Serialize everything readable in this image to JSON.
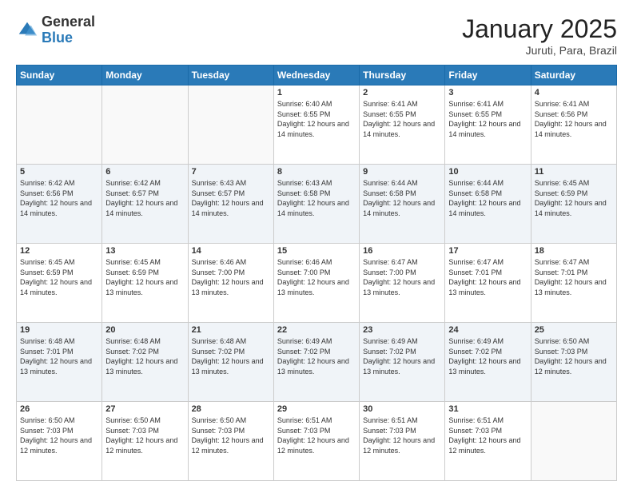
{
  "header": {
    "logo_general": "General",
    "logo_blue": "Blue",
    "month_title": "January 2025",
    "subtitle": "Juruti, Para, Brazil"
  },
  "days_of_week": [
    "Sunday",
    "Monday",
    "Tuesday",
    "Wednesday",
    "Thursday",
    "Friday",
    "Saturday"
  ],
  "weeks": [
    [
      {
        "day": "",
        "sunrise": "",
        "sunset": "",
        "daylight": ""
      },
      {
        "day": "",
        "sunrise": "",
        "sunset": "",
        "daylight": ""
      },
      {
        "day": "",
        "sunrise": "",
        "sunset": "",
        "daylight": ""
      },
      {
        "day": "1",
        "sunrise": "Sunrise: 6:40 AM",
        "sunset": "Sunset: 6:55 PM",
        "daylight": "Daylight: 12 hours and 14 minutes."
      },
      {
        "day": "2",
        "sunrise": "Sunrise: 6:41 AM",
        "sunset": "Sunset: 6:55 PM",
        "daylight": "Daylight: 12 hours and 14 minutes."
      },
      {
        "day": "3",
        "sunrise": "Sunrise: 6:41 AM",
        "sunset": "Sunset: 6:55 PM",
        "daylight": "Daylight: 12 hours and 14 minutes."
      },
      {
        "day": "4",
        "sunrise": "Sunrise: 6:41 AM",
        "sunset": "Sunset: 6:56 PM",
        "daylight": "Daylight: 12 hours and 14 minutes."
      }
    ],
    [
      {
        "day": "5",
        "sunrise": "Sunrise: 6:42 AM",
        "sunset": "Sunset: 6:56 PM",
        "daylight": "Daylight: 12 hours and 14 minutes."
      },
      {
        "day": "6",
        "sunrise": "Sunrise: 6:42 AM",
        "sunset": "Sunset: 6:57 PM",
        "daylight": "Daylight: 12 hours and 14 minutes."
      },
      {
        "day": "7",
        "sunrise": "Sunrise: 6:43 AM",
        "sunset": "Sunset: 6:57 PM",
        "daylight": "Daylight: 12 hours and 14 minutes."
      },
      {
        "day": "8",
        "sunrise": "Sunrise: 6:43 AM",
        "sunset": "Sunset: 6:58 PM",
        "daylight": "Daylight: 12 hours and 14 minutes."
      },
      {
        "day": "9",
        "sunrise": "Sunrise: 6:44 AM",
        "sunset": "Sunset: 6:58 PM",
        "daylight": "Daylight: 12 hours and 14 minutes."
      },
      {
        "day": "10",
        "sunrise": "Sunrise: 6:44 AM",
        "sunset": "Sunset: 6:58 PM",
        "daylight": "Daylight: 12 hours and 14 minutes."
      },
      {
        "day": "11",
        "sunrise": "Sunrise: 6:45 AM",
        "sunset": "Sunset: 6:59 PM",
        "daylight": "Daylight: 12 hours and 14 minutes."
      }
    ],
    [
      {
        "day": "12",
        "sunrise": "Sunrise: 6:45 AM",
        "sunset": "Sunset: 6:59 PM",
        "daylight": "Daylight: 12 hours and 14 minutes."
      },
      {
        "day": "13",
        "sunrise": "Sunrise: 6:45 AM",
        "sunset": "Sunset: 6:59 PM",
        "daylight": "Daylight: 12 hours and 13 minutes."
      },
      {
        "day": "14",
        "sunrise": "Sunrise: 6:46 AM",
        "sunset": "Sunset: 7:00 PM",
        "daylight": "Daylight: 12 hours and 13 minutes."
      },
      {
        "day": "15",
        "sunrise": "Sunrise: 6:46 AM",
        "sunset": "Sunset: 7:00 PM",
        "daylight": "Daylight: 12 hours and 13 minutes."
      },
      {
        "day": "16",
        "sunrise": "Sunrise: 6:47 AM",
        "sunset": "Sunset: 7:00 PM",
        "daylight": "Daylight: 12 hours and 13 minutes."
      },
      {
        "day": "17",
        "sunrise": "Sunrise: 6:47 AM",
        "sunset": "Sunset: 7:01 PM",
        "daylight": "Daylight: 12 hours and 13 minutes."
      },
      {
        "day": "18",
        "sunrise": "Sunrise: 6:47 AM",
        "sunset": "Sunset: 7:01 PM",
        "daylight": "Daylight: 12 hours and 13 minutes."
      }
    ],
    [
      {
        "day": "19",
        "sunrise": "Sunrise: 6:48 AM",
        "sunset": "Sunset: 7:01 PM",
        "daylight": "Daylight: 12 hours and 13 minutes."
      },
      {
        "day": "20",
        "sunrise": "Sunrise: 6:48 AM",
        "sunset": "Sunset: 7:02 PM",
        "daylight": "Daylight: 12 hours and 13 minutes."
      },
      {
        "day": "21",
        "sunrise": "Sunrise: 6:48 AM",
        "sunset": "Sunset: 7:02 PM",
        "daylight": "Daylight: 12 hours and 13 minutes."
      },
      {
        "day": "22",
        "sunrise": "Sunrise: 6:49 AM",
        "sunset": "Sunset: 7:02 PM",
        "daylight": "Daylight: 12 hours and 13 minutes."
      },
      {
        "day": "23",
        "sunrise": "Sunrise: 6:49 AM",
        "sunset": "Sunset: 7:02 PM",
        "daylight": "Daylight: 12 hours and 13 minutes."
      },
      {
        "day": "24",
        "sunrise": "Sunrise: 6:49 AM",
        "sunset": "Sunset: 7:02 PM",
        "daylight": "Daylight: 12 hours and 13 minutes."
      },
      {
        "day": "25",
        "sunrise": "Sunrise: 6:50 AM",
        "sunset": "Sunset: 7:03 PM",
        "daylight": "Daylight: 12 hours and 12 minutes."
      }
    ],
    [
      {
        "day": "26",
        "sunrise": "Sunrise: 6:50 AM",
        "sunset": "Sunset: 7:03 PM",
        "daylight": "Daylight: 12 hours and 12 minutes."
      },
      {
        "day": "27",
        "sunrise": "Sunrise: 6:50 AM",
        "sunset": "Sunset: 7:03 PM",
        "daylight": "Daylight: 12 hours and 12 minutes."
      },
      {
        "day": "28",
        "sunrise": "Sunrise: 6:50 AM",
        "sunset": "Sunset: 7:03 PM",
        "daylight": "Daylight: 12 hours and 12 minutes."
      },
      {
        "day": "29",
        "sunrise": "Sunrise: 6:51 AM",
        "sunset": "Sunset: 7:03 PM",
        "daylight": "Daylight: 12 hours and 12 minutes."
      },
      {
        "day": "30",
        "sunrise": "Sunrise: 6:51 AM",
        "sunset": "Sunset: 7:03 PM",
        "daylight": "Daylight: 12 hours and 12 minutes."
      },
      {
        "day": "31",
        "sunrise": "Sunrise: 6:51 AM",
        "sunset": "Sunset: 7:03 PM",
        "daylight": "Daylight: 12 hours and 12 minutes."
      },
      {
        "day": "",
        "sunrise": "",
        "sunset": "",
        "daylight": ""
      }
    ]
  ]
}
